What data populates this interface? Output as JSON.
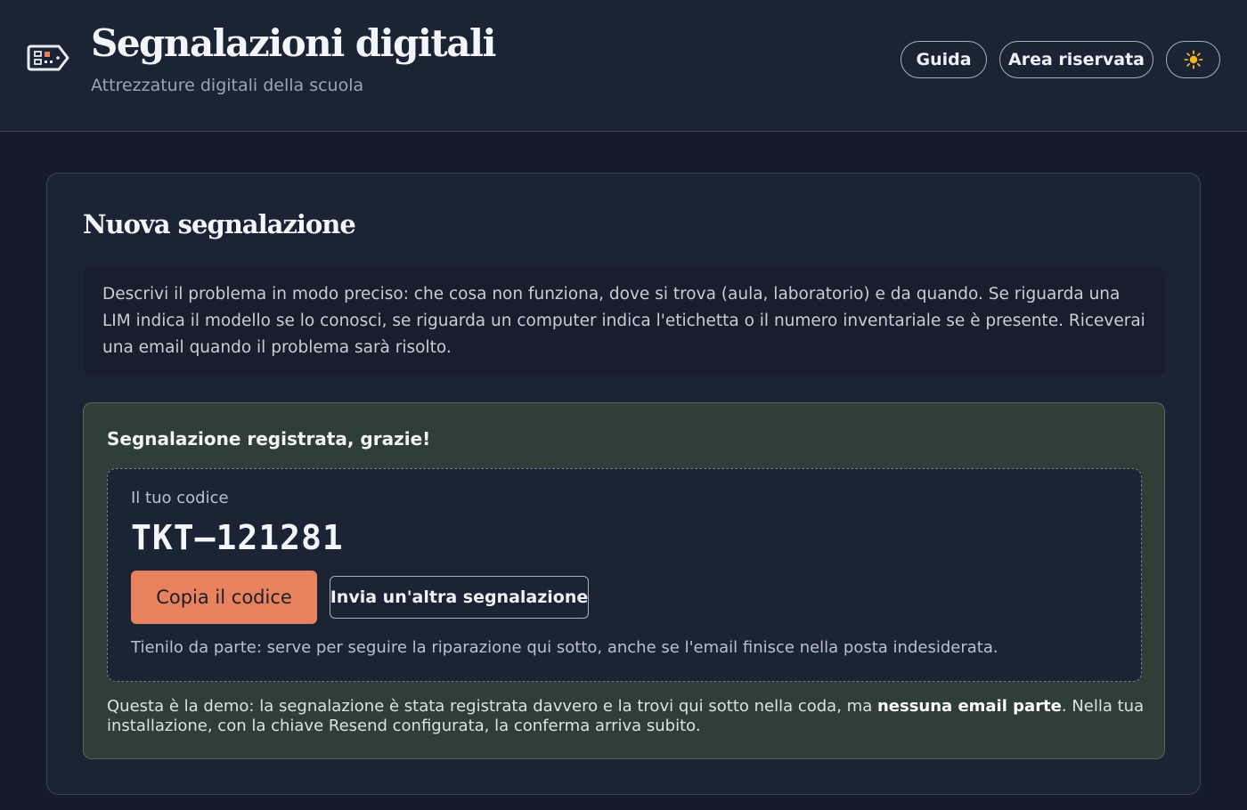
{
  "header": {
    "title": "Segnalazioni digitali",
    "subtitle": "Attrezzature digitali della scuola",
    "logo_icon": "ticket-icon",
    "nav": {
      "guide_label": "Guida",
      "reserved_label": "Area riservata",
      "theme_icon": "sun-icon"
    }
  },
  "form": {
    "title": "Nuova segnalazione",
    "instructions": "Descrivi il problema in modo preciso: che cosa non funziona, dove si trova (aula, laboratorio) e da quando. Se riguarda una LIM indica il modello se lo conosci, se riguarda un computer indica l'etichetta o il numero inventariale se è presente. Riceverai una email quando il problema sarà risolto."
  },
  "success": {
    "title": "Segnalazione registrata, grazie!",
    "code_label": "Il tuo codice",
    "code": "TKT–121281",
    "copy_label": "Copia il codice",
    "another_label": "Invia un'altra segnalazione",
    "hint": "Tienilo da parte: serve per seguire la riparazione qui sotto, anche se l'email finisce nella posta indesiderata.",
    "demo_note_before": "Questa è la demo: la segnalazione è stata registrata davvero e la trovi qui sotto nella coda, ma ",
    "demo_note_bold": "nessuna email parte",
    "demo_note_after": ". Nella tua installazione, con la chiave Resend configurata, la conferma arriva subito."
  },
  "colors": {
    "background": "#151c29",
    "panel": "#1b2435",
    "accent": "#e8825e",
    "success_bg": "#2f3f38",
    "success_border": "#4c6b56"
  }
}
